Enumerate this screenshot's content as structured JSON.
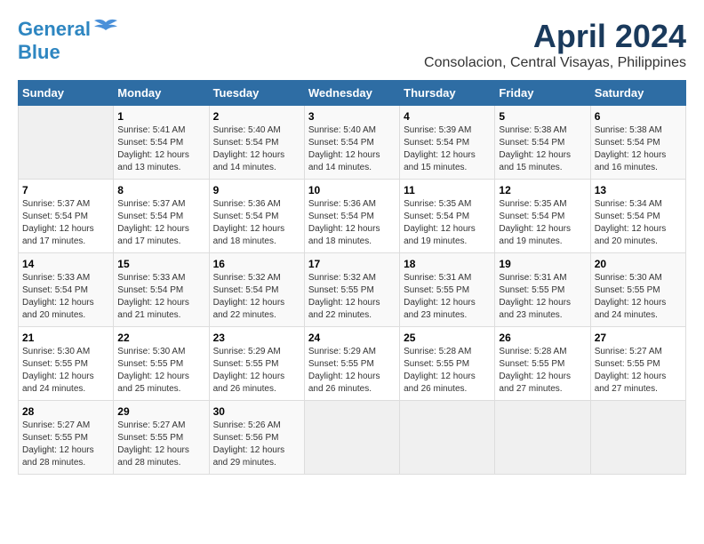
{
  "header": {
    "logo_line1": "General",
    "logo_line2": "Blue",
    "title": "April 2024",
    "subtitle": "Consolacion, Central Visayas, Philippines"
  },
  "days_of_week": [
    "Sunday",
    "Monday",
    "Tuesday",
    "Wednesday",
    "Thursday",
    "Friday",
    "Saturday"
  ],
  "weeks": [
    [
      {
        "num": "",
        "sunrise": "",
        "sunset": "",
        "daylight": ""
      },
      {
        "num": "1",
        "sunrise": "Sunrise: 5:41 AM",
        "sunset": "Sunset: 5:54 PM",
        "daylight": "Daylight: 12 hours and 13 minutes."
      },
      {
        "num": "2",
        "sunrise": "Sunrise: 5:40 AM",
        "sunset": "Sunset: 5:54 PM",
        "daylight": "Daylight: 12 hours and 14 minutes."
      },
      {
        "num": "3",
        "sunrise": "Sunrise: 5:40 AM",
        "sunset": "Sunset: 5:54 PM",
        "daylight": "Daylight: 12 hours and 14 minutes."
      },
      {
        "num": "4",
        "sunrise": "Sunrise: 5:39 AM",
        "sunset": "Sunset: 5:54 PM",
        "daylight": "Daylight: 12 hours and 15 minutes."
      },
      {
        "num": "5",
        "sunrise": "Sunrise: 5:38 AM",
        "sunset": "Sunset: 5:54 PM",
        "daylight": "Daylight: 12 hours and 15 minutes."
      },
      {
        "num": "6",
        "sunrise": "Sunrise: 5:38 AM",
        "sunset": "Sunset: 5:54 PM",
        "daylight": "Daylight: 12 hours and 16 minutes."
      }
    ],
    [
      {
        "num": "7",
        "sunrise": "Sunrise: 5:37 AM",
        "sunset": "Sunset: 5:54 PM",
        "daylight": "Daylight: 12 hours and 17 minutes."
      },
      {
        "num": "8",
        "sunrise": "Sunrise: 5:37 AM",
        "sunset": "Sunset: 5:54 PM",
        "daylight": "Daylight: 12 hours and 17 minutes."
      },
      {
        "num": "9",
        "sunrise": "Sunrise: 5:36 AM",
        "sunset": "Sunset: 5:54 PM",
        "daylight": "Daylight: 12 hours and 18 minutes."
      },
      {
        "num": "10",
        "sunrise": "Sunrise: 5:36 AM",
        "sunset": "Sunset: 5:54 PM",
        "daylight": "Daylight: 12 hours and 18 minutes."
      },
      {
        "num": "11",
        "sunrise": "Sunrise: 5:35 AM",
        "sunset": "Sunset: 5:54 PM",
        "daylight": "Daylight: 12 hours and 19 minutes."
      },
      {
        "num": "12",
        "sunrise": "Sunrise: 5:35 AM",
        "sunset": "Sunset: 5:54 PM",
        "daylight": "Daylight: 12 hours and 19 minutes."
      },
      {
        "num": "13",
        "sunrise": "Sunrise: 5:34 AM",
        "sunset": "Sunset: 5:54 PM",
        "daylight": "Daylight: 12 hours and 20 minutes."
      }
    ],
    [
      {
        "num": "14",
        "sunrise": "Sunrise: 5:33 AM",
        "sunset": "Sunset: 5:54 PM",
        "daylight": "Daylight: 12 hours and 20 minutes."
      },
      {
        "num": "15",
        "sunrise": "Sunrise: 5:33 AM",
        "sunset": "Sunset: 5:54 PM",
        "daylight": "Daylight: 12 hours and 21 minutes."
      },
      {
        "num": "16",
        "sunrise": "Sunrise: 5:32 AM",
        "sunset": "Sunset: 5:54 PM",
        "daylight": "Daylight: 12 hours and 22 minutes."
      },
      {
        "num": "17",
        "sunrise": "Sunrise: 5:32 AM",
        "sunset": "Sunset: 5:55 PM",
        "daylight": "Daylight: 12 hours and 22 minutes."
      },
      {
        "num": "18",
        "sunrise": "Sunrise: 5:31 AM",
        "sunset": "Sunset: 5:55 PM",
        "daylight": "Daylight: 12 hours and 23 minutes."
      },
      {
        "num": "19",
        "sunrise": "Sunrise: 5:31 AM",
        "sunset": "Sunset: 5:55 PM",
        "daylight": "Daylight: 12 hours and 23 minutes."
      },
      {
        "num": "20",
        "sunrise": "Sunrise: 5:30 AM",
        "sunset": "Sunset: 5:55 PM",
        "daylight": "Daylight: 12 hours and 24 minutes."
      }
    ],
    [
      {
        "num": "21",
        "sunrise": "Sunrise: 5:30 AM",
        "sunset": "Sunset: 5:55 PM",
        "daylight": "Daylight: 12 hours and 24 minutes."
      },
      {
        "num": "22",
        "sunrise": "Sunrise: 5:30 AM",
        "sunset": "Sunset: 5:55 PM",
        "daylight": "Daylight: 12 hours and 25 minutes."
      },
      {
        "num": "23",
        "sunrise": "Sunrise: 5:29 AM",
        "sunset": "Sunset: 5:55 PM",
        "daylight": "Daylight: 12 hours and 26 minutes."
      },
      {
        "num": "24",
        "sunrise": "Sunrise: 5:29 AM",
        "sunset": "Sunset: 5:55 PM",
        "daylight": "Daylight: 12 hours and 26 minutes."
      },
      {
        "num": "25",
        "sunrise": "Sunrise: 5:28 AM",
        "sunset": "Sunset: 5:55 PM",
        "daylight": "Daylight: 12 hours and 26 minutes."
      },
      {
        "num": "26",
        "sunrise": "Sunrise: 5:28 AM",
        "sunset": "Sunset: 5:55 PM",
        "daylight": "Daylight: 12 hours and 27 minutes."
      },
      {
        "num": "27",
        "sunrise": "Sunrise: 5:27 AM",
        "sunset": "Sunset: 5:55 PM",
        "daylight": "Daylight: 12 hours and 27 minutes."
      }
    ],
    [
      {
        "num": "28",
        "sunrise": "Sunrise: 5:27 AM",
        "sunset": "Sunset: 5:55 PM",
        "daylight": "Daylight: 12 hours and 28 minutes."
      },
      {
        "num": "29",
        "sunrise": "Sunrise: 5:27 AM",
        "sunset": "Sunset: 5:55 PM",
        "daylight": "Daylight: 12 hours and 28 minutes."
      },
      {
        "num": "30",
        "sunrise": "Sunrise: 5:26 AM",
        "sunset": "Sunset: 5:56 PM",
        "daylight": "Daylight: 12 hours and 29 minutes."
      },
      {
        "num": "",
        "sunrise": "",
        "sunset": "",
        "daylight": ""
      },
      {
        "num": "",
        "sunrise": "",
        "sunset": "",
        "daylight": ""
      },
      {
        "num": "",
        "sunrise": "",
        "sunset": "",
        "daylight": ""
      },
      {
        "num": "",
        "sunrise": "",
        "sunset": "",
        "daylight": ""
      }
    ]
  ]
}
